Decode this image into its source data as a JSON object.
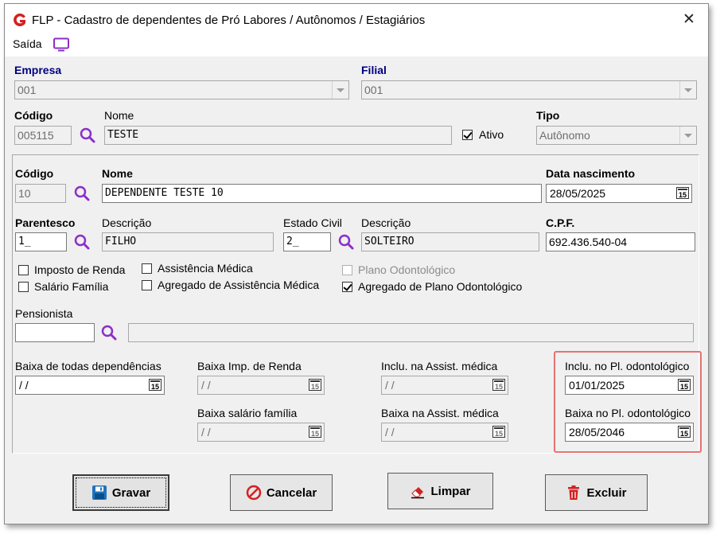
{
  "window": {
    "title": "FLP - Cadastro de dependentes de Pró Labores / Autônomos / Estagiários",
    "logo": "G",
    "close": "✕"
  },
  "menu": {
    "exit_label": "Saída"
  },
  "header": {
    "empresa_label": "Empresa",
    "empresa_value": "001",
    "filial_label": "Filial",
    "filial_value": "001",
    "codigo_label": "Código",
    "codigo_value": "005115",
    "nome_label": "Nome",
    "nome_value": "TESTE",
    "ativo_label": "Ativo",
    "ativo_checked": true,
    "tipo_label": "Tipo",
    "tipo_value": "Autônomo"
  },
  "dependent": {
    "codigo_label": "Código",
    "codigo_value": "10",
    "nome_label": "Nome",
    "nome_value": "DEPENDENTE TESTE 10",
    "nascimento_label": "Data nascimento",
    "nascimento_value": "28/05/2025",
    "parentesco_label": "Parentesco",
    "parentesco_value": "1_",
    "parentesco_desc_label": "Descrição",
    "parentesco_desc_value": "FILHO",
    "estado_civil_label": "Estado Civil",
    "estado_civil_value": "2_",
    "estado_desc_label": "Descrição",
    "estado_desc_value": "SOLTEIRO",
    "cpf_label": "C.P.F.",
    "cpf_value": "692.436.540-04"
  },
  "checkboxes": {
    "imposto_renda": "Imposto de Renda",
    "salario_familia": "Salário Família",
    "assistencia_medica": "Assistência Médica",
    "agregado_assistencia": "Agregado de Assistência Médica",
    "plano_odontologico": "Plano Odontológico",
    "agregado_plano": "Agregado de Plano Odontológico"
  },
  "pensionista": {
    "label": "Pensionista",
    "value": "",
    "name_value": ""
  },
  "dates": {
    "baixa_todas_label": "Baixa de todas dependências",
    "baixa_todas_value": " / /",
    "baixa_imp_label": "Baixa Imp. de Renda",
    "baixa_imp_value": " / /",
    "baixa_sal_label": "Baixa salário família",
    "baixa_sal_value": " / /",
    "inclu_assist_label": "Inclu. na Assist. médica",
    "inclu_assist_value": " / /",
    "baixa_assist_label": "Baixa na Assist. médica",
    "baixa_assist_value": " / /",
    "inclu_odonto_label": "Inclu. no Pl. odontológico",
    "inclu_odonto_value": "01/01/2025",
    "baixa_odonto_label": "Baixa no Pl. odontológico",
    "baixa_odonto_value": "28/05/2046",
    "calendar_text": "15"
  },
  "buttons": {
    "gravar": "Gravar",
    "cancelar": "Cancelar",
    "limpar": "Limpar",
    "excluir": "Excluir"
  },
  "colors": {
    "accent_purple": "#8b2fc9",
    "logo_red": "#d42020",
    "highlight_box": "#e57373",
    "label_blue": "#000080"
  }
}
